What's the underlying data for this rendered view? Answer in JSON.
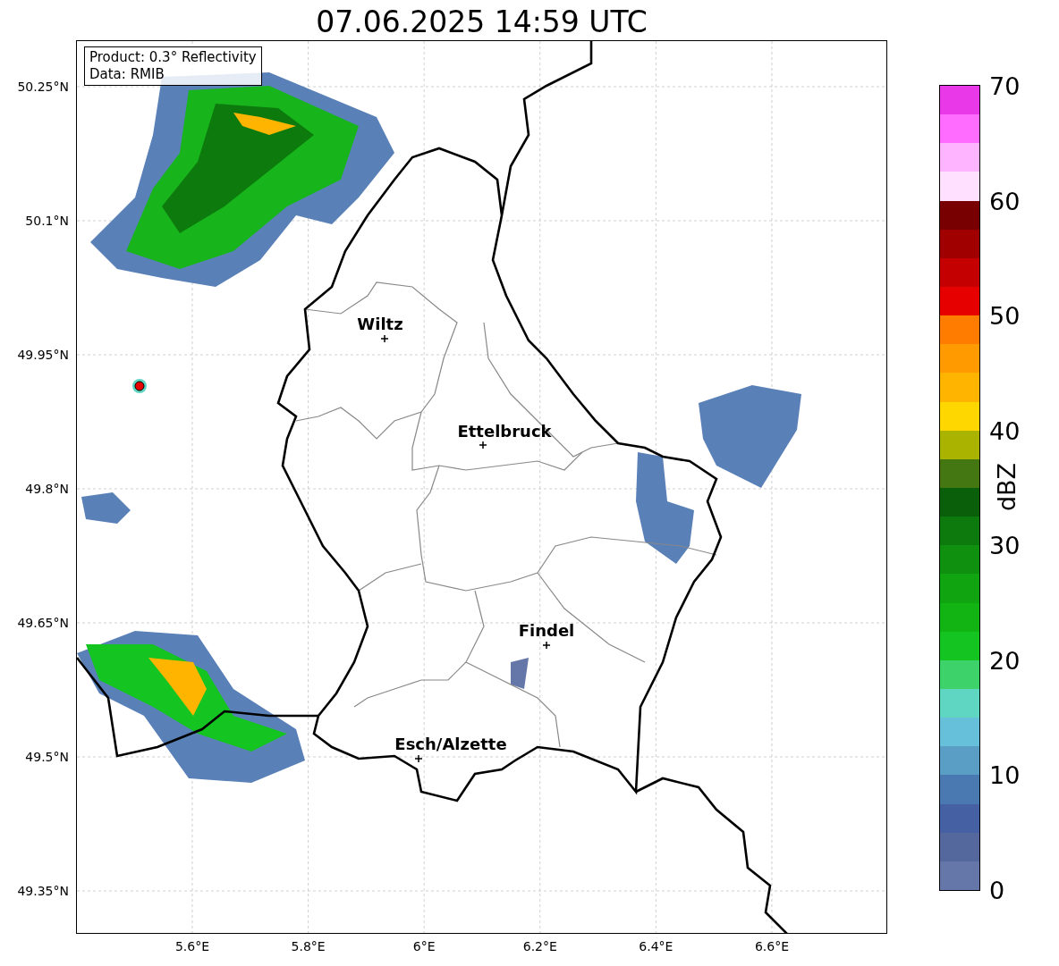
{
  "title": "07.06.2025 14:59 UTC",
  "info_box": {
    "lines": [
      "Product: 0.3° Reflectivity",
      "Data: RMIB"
    ]
  },
  "y_ticks": [
    "50.25°N",
    "50.1°N",
    "49.95°N",
    "49.8°N",
    "49.65°N",
    "49.5°N",
    "49.35°N"
  ],
  "x_ticks": [
    "5.6°E",
    "5.8°E",
    "6°E",
    "6.2°E",
    "6.4°E",
    "6.6°E"
  ],
  "cities": [
    {
      "name": "Wiltz"
    },
    {
      "name": "Ettelbruck"
    },
    {
      "name": "Findel"
    },
    {
      "name": "Esch/Alzette"
    }
  ],
  "colorbar": {
    "label": "dBZ",
    "ticks": [
      "70",
      "60",
      "50",
      "40",
      "30",
      "20",
      "10",
      "0"
    ],
    "segments": [
      {
        "color": "#6577a8"
      },
      {
        "color": "#55689e"
      },
      {
        "color": "#4660a4"
      },
      {
        "color": "#4a78b0"
      },
      {
        "color": "#5a9ec6"
      },
      {
        "color": "#67c0da"
      },
      {
        "color": "#5ed6c2"
      },
      {
        "color": "#3ed26a"
      },
      {
        "color": "#14c420"
      },
      {
        "color": "#12b414"
      },
      {
        "color": "#11a411"
      },
      {
        "color": "#0f900f"
      },
      {
        "color": "#0d7a0d"
      },
      {
        "color": "#0a600a"
      },
      {
        "color": "#447711"
      },
      {
        "color": "#aab300"
      },
      {
        "color": "#ffd700"
      },
      {
        "color": "#ffb400"
      },
      {
        "color": "#ff9a00"
      },
      {
        "color": "#ff7c00"
      },
      {
        "color": "#e60000"
      },
      {
        "color": "#c40000"
      },
      {
        "color": "#a00000"
      },
      {
        "color": "#780000"
      },
      {
        "color": "#ffe0ff"
      },
      {
        "color": "#ffb4ff"
      },
      {
        "color": "#ff6cff"
      },
      {
        "color": "#e838e8"
      }
    ]
  }
}
